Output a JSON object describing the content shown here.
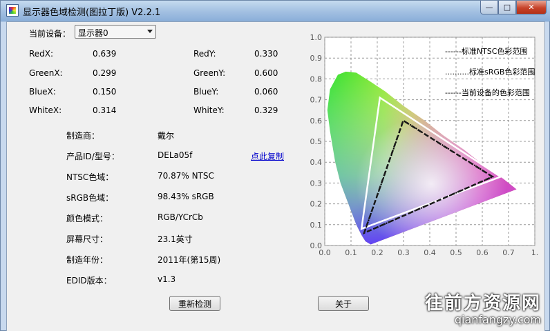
{
  "window": {
    "title": "显示器色域检测(图拉丁版) V2.2.1",
    "min": "—",
    "max": "□",
    "close": "✕"
  },
  "device": {
    "label": "当前设备：",
    "selected": "显示器0"
  },
  "coords": {
    "redx": {
      "label": "RedX:",
      "value": "0.639"
    },
    "redy": {
      "label": "RedY:",
      "value": "0.330"
    },
    "greenx": {
      "label": "GreenX:",
      "value": "0.299"
    },
    "greeny": {
      "label": "GreenY:",
      "value": "0.600"
    },
    "bluex": {
      "label": "BlueX:",
      "value": "0.150"
    },
    "bluey": {
      "label": "BlueY:",
      "value": "0.060"
    },
    "whitex": {
      "label": "WhiteX:",
      "value": "0.314"
    },
    "whitey": {
      "label": "WhiteY:",
      "value": "0.329"
    }
  },
  "info": [
    {
      "label": "制造商：",
      "value": "戴尔"
    },
    {
      "label": "产品ID/型号：",
      "value": "DELa05f"
    },
    {
      "label": "NTSC色域：",
      "value": "70.87% NTSC"
    },
    {
      "label": "sRGB色域：",
      "value": "98.43% sRGB"
    },
    {
      "label": "颜色模式：",
      "value": "RGB/YCrCb"
    },
    {
      "label": "屏幕尺寸：",
      "value": "23.1英寸"
    },
    {
      "label": "制造年份：",
      "value": "2011年(第15周)"
    },
    {
      "label": "EDID版本：",
      "value": "v1.3"
    }
  ],
  "copy_link": "点此复制",
  "buttons": {
    "recheck": "重新检测",
    "about": "关于"
  },
  "chart_data": {
    "type": "scatter",
    "xlim": [
      0,
      0.8
    ],
    "ylim": [
      0,
      1.0
    ],
    "xticks": [
      "0.0",
      "0.1",
      "0.2",
      "0.3",
      "0.4",
      "0.5",
      "0.6",
      "0.7",
      "0.8"
    ],
    "yticks": [
      "0.0",
      "0.1",
      "0.2",
      "0.3",
      "0.4",
      "0.5",
      "0.6",
      "0.7",
      "0.8",
      "0.9",
      "1.0"
    ],
    "grid": true,
    "legend": [
      {
        "name": "------标准NTSC色彩范围"
      },
      {
        "name": "..........标准sRGB色彩范围"
      },
      {
        "name": "------当前设备的色彩范围"
      }
    ],
    "series": [
      {
        "name": "标准NTSC色彩范围",
        "points": [
          [
            0.67,
            0.33
          ],
          [
            0.21,
            0.71
          ],
          [
            0.14,
            0.08
          ]
        ],
        "color": "#ffffff"
      },
      {
        "name": "标准sRGB色彩范围",
        "points": [
          [
            0.64,
            0.33
          ],
          [
            0.3,
            0.6
          ],
          [
            0.15,
            0.06
          ]
        ],
        "color": "#000000"
      },
      {
        "name": "当前设备的色彩范围",
        "points": [
          [
            0.639,
            0.33
          ],
          [
            0.299,
            0.6
          ],
          [
            0.15,
            0.06
          ]
        ],
        "color": "#333333"
      }
    ]
  },
  "watermark": {
    "line1": "往前方资源网",
    "line2": "qianfangzy.com"
  }
}
